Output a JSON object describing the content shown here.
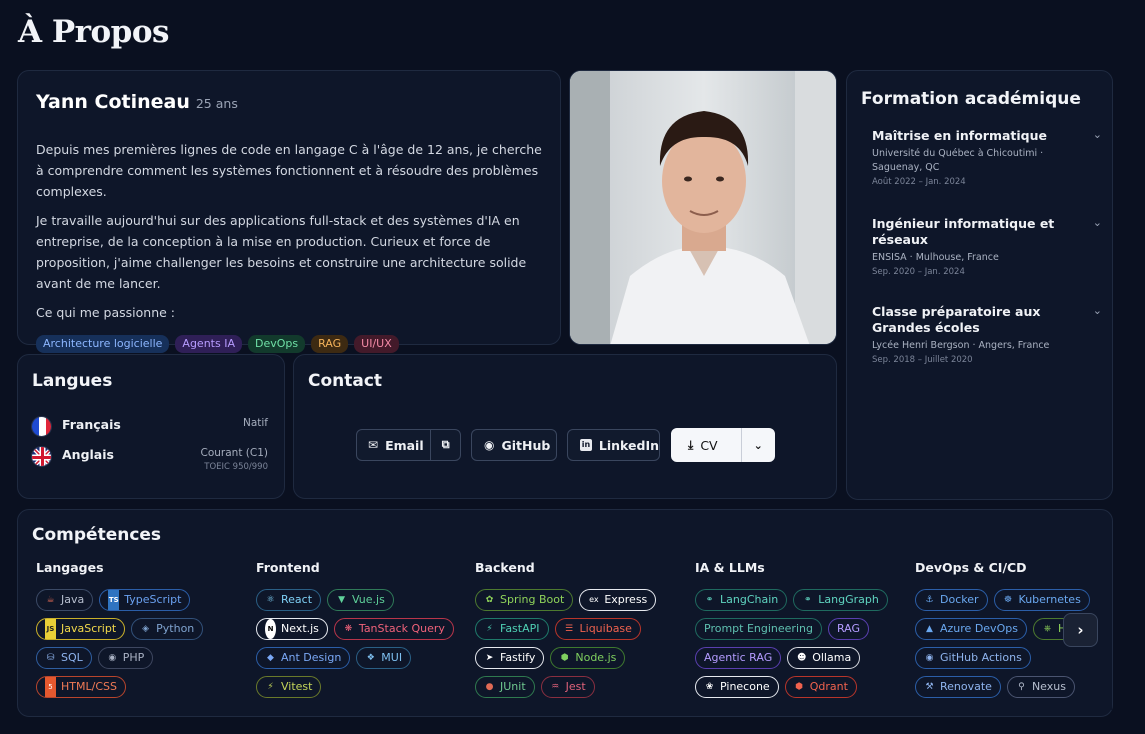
{
  "page_title": "À Propos",
  "bio": {
    "name": "Yann Cotineau",
    "age": "25 ans",
    "p1": "Depuis mes premières lignes de code en langage C à l'âge de 12 ans, je cherche à comprendre comment les systèmes fonctionnent et à résoudre des problèmes complexes.",
    "p2": "Je travaille aujourd'hui sur des applications full-stack et des systèmes d'IA en entreprise, de la conception à la mise en production. Curieux et force de proposition, j'aime challenger les besoins et construire une architecture solide avant de me lancer.",
    "p3": "Ce qui me passionne :",
    "tags": [
      "Architecture logicielle",
      "Agents IA",
      "DevOps",
      "RAG",
      "UI/UX"
    ]
  },
  "formation": {
    "title": "Formation académique",
    "items": [
      {
        "title": "Maîtrise en informatique",
        "school": "Université du Québec à Chicoutimi · Saguenay, QC",
        "dates": "Août 2022 – Jan. 2024"
      },
      {
        "title": "Ingénieur informatique et réseaux",
        "school": "ENSISA · Mulhouse, France",
        "dates": "Sep. 2020 – Jan. 2024"
      },
      {
        "title": "Classe préparatoire aux Grandes écoles",
        "school": "Lycée Henri Bergson · Angers, France",
        "dates": "Sep. 2018 – Juillet 2020"
      }
    ]
  },
  "langues": {
    "title": "Langues",
    "items": [
      {
        "name": "Français",
        "level": "Natif",
        "sub": ""
      },
      {
        "name": "Anglais",
        "level": "Courant (C1)",
        "sub": "TOEIC 950/990"
      }
    ]
  },
  "contact": {
    "title": "Contact",
    "email": "Email",
    "github": "GitHub",
    "linkedin": "LinkedIn",
    "cv": "CV"
  },
  "competences": {
    "title": "Compétences",
    "columns": [
      {
        "title": "Langages"
      },
      {
        "title": "Frontend"
      },
      {
        "title": "Backend"
      },
      {
        "title": "IA & LLMs"
      },
      {
        "title": "DevOps & CI/CD"
      }
    ],
    "langages": [
      "Java",
      "TypeScript",
      "JavaScript",
      "Python",
      "SQL",
      "PHP",
      "HTML/CSS"
    ],
    "frontend": [
      "React",
      "Vue.js",
      "Next.js",
      "TanStack Query",
      "Ant Design",
      "MUI",
      "Vitest"
    ],
    "backend": [
      "Spring Boot",
      "Express",
      "FastAPI",
      "Liquibase",
      "Fastify",
      "Node.js",
      "JUnit",
      "Jest"
    ],
    "ia": [
      "LangChain",
      "LangGraph",
      "Prompt Engineering",
      "RAG",
      "Agentic RAG",
      "Ollama",
      "Pinecone",
      "Qdrant"
    ],
    "devops": [
      "Docker",
      "Kubernetes",
      "Azure DevOps",
      "H",
      "GitHub Actions",
      "Renovate",
      "Nexus"
    ],
    "next_label": "›"
  },
  "icons": [
    "mail-icon",
    "copy-icon",
    "github-icon",
    "linkedin-icon",
    "download-icon",
    "chevron-down-icon",
    "chevron-right-icon"
  ]
}
